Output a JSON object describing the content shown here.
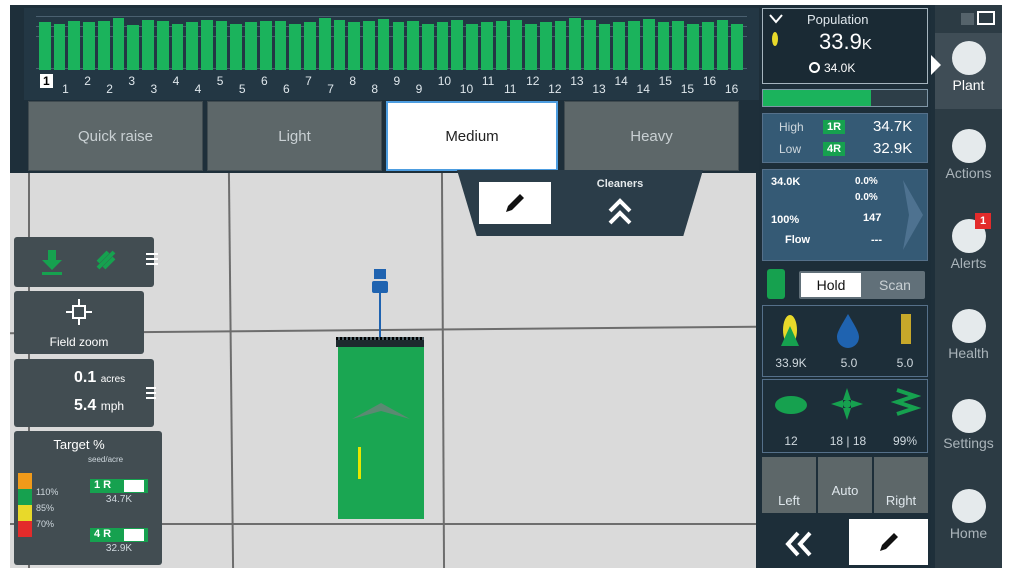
{
  "graph": {
    "row_labels": [
      "1",
      "1",
      "2",
      "2",
      "3",
      "3",
      "4",
      "4",
      "5",
      "5",
      "6",
      "6",
      "7",
      "7",
      "8",
      "8",
      "9",
      "9",
      "10",
      "10",
      "11",
      "11",
      "12",
      "12",
      "13",
      "13",
      "14",
      "14",
      "15",
      "15",
      "16",
      "16"
    ],
    "bar_levels": [
      0.82,
      0.8,
      0.84,
      0.83,
      0.85,
      0.9,
      0.78,
      0.86,
      0.84,
      0.8,
      0.82,
      0.86,
      0.84,
      0.8,
      0.82,
      0.85,
      0.84,
      0.8,
      0.82,
      0.9,
      0.86,
      0.82,
      0.84,
      0.88,
      0.82,
      0.84,
      0.8,
      0.82,
      0.86,
      0.8,
      0.82,
      0.84,
      0.86,
      0.8,
      0.82,
      0.84,
      0.9,
      0.86,
      0.8,
      0.82,
      0.84,
      0.88,
      0.82,
      0.84,
      0.8,
      0.82,
      0.86,
      0.8
    ],
    "colors": {
      "bar": "#1bb35c",
      "bg": "#233744"
    }
  },
  "downforce": {
    "buttons": [
      "Quick raise",
      "Light",
      "Medium",
      "Heavy"
    ],
    "selected": "Medium"
  },
  "cleaners": {
    "label": "Cleaners"
  },
  "left_panel": {
    "field_zoom": "Field zoom",
    "acres_value": "0.1",
    "acres_unit": "acres",
    "speed_value": "5.4",
    "speed_unit": "mph",
    "target_title": "Target %",
    "target_sub": "seed/acre",
    "legend": [
      "110%",
      "85%",
      "70%"
    ],
    "row_high_tag": "1 R",
    "row_high_value": "34.7K",
    "row_low_tag": "4 R",
    "row_low_value": "32.9K"
  },
  "population": {
    "title": "Population",
    "value": "33.9",
    "unit": "K",
    "target_value": "34.0K"
  },
  "highlow": {
    "high_label": "High",
    "high_tag": "1R",
    "high_value": "34.7K",
    "low_label": "Low",
    "low_tag": "4R",
    "low_value": "32.9K"
  },
  "metrics": {
    "seed": "34.0K",
    "singulation": "0.0%",
    "doubles": "0.0%",
    "good_spacing": "100%",
    "ride_quality": "147",
    "flow_label": "Flow",
    "flow_value": "---"
  },
  "hold_scan": {
    "hold": "Hold",
    "scan": "Scan"
  },
  "stats1": [
    "33.9K",
    "5.0",
    "5.0"
  ],
  "stats2": [
    "12",
    "18 | 18",
    "99%"
  ],
  "steer": {
    "left": "Left",
    "auto": "Auto",
    "right": "Right"
  },
  "nav": {
    "items": [
      "Plant",
      "Actions",
      "Alerts",
      "Health",
      "Settings",
      "Home"
    ],
    "alerts_badge": "1"
  }
}
